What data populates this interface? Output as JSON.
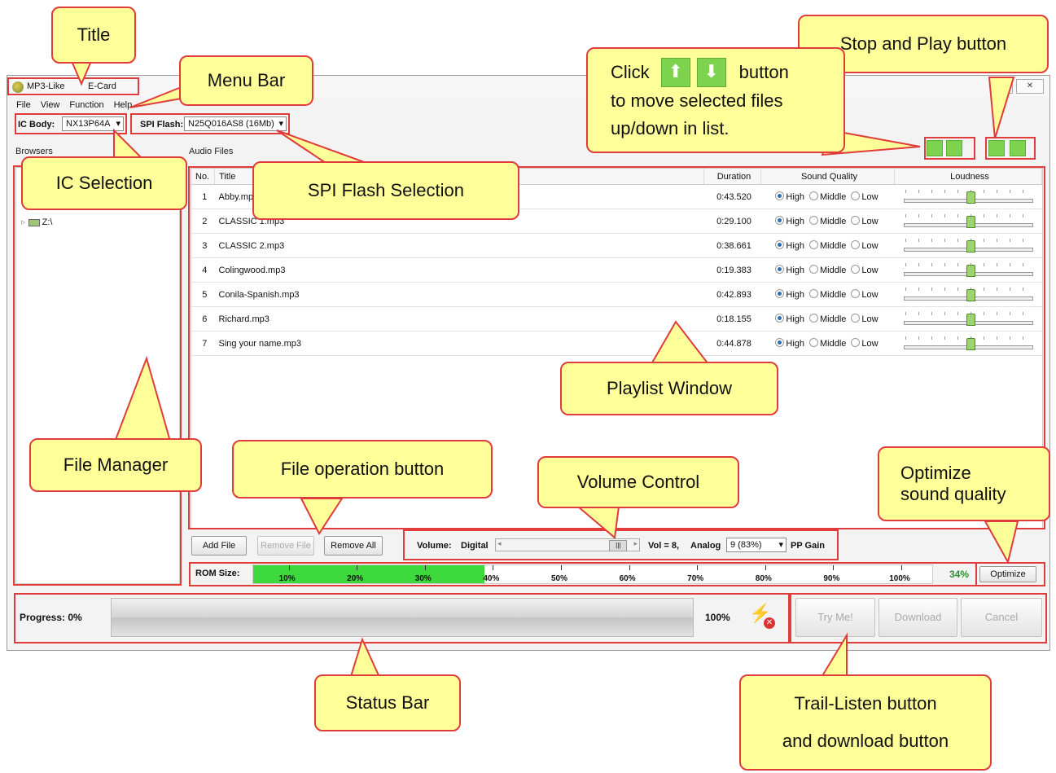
{
  "window": {
    "title": "MP3-Like",
    "subtitle": "E-Card"
  },
  "menu": [
    "File",
    "View",
    "Function",
    "Help"
  ],
  "toolbar": {
    "ic_body_label": "IC Body:",
    "ic_body_value": "NX13P64A",
    "spi_flash_label": "SPI Flash:",
    "spi_flash_value": "N25Q016AS8 (16Mb)"
  },
  "browser": {
    "label": "Browsers",
    "drive": "Z:\\"
  },
  "playlist": {
    "label": "Audio Files",
    "columns": [
      "No.",
      "Title",
      "Duration",
      "Sound Quality",
      "Loudness"
    ],
    "quality_options": [
      "High",
      "Middle",
      "Low"
    ],
    "rows": [
      {
        "no": "1",
        "title": "Abby.mp3",
        "duration": "0:43.520",
        "quality": "High",
        "loudness": 0.5
      },
      {
        "no": "2",
        "title": "CLASSIC 1.mp3",
        "duration": "0:29.100",
        "quality": "High",
        "loudness": 0.5
      },
      {
        "no": "3",
        "title": "CLASSIC 2.mp3",
        "duration": "0:38.661",
        "quality": "High",
        "loudness": 0.5
      },
      {
        "no": "4",
        "title": "Colingwood.mp3",
        "duration": "0:19.383",
        "quality": "High",
        "loudness": 0.5
      },
      {
        "no": "5",
        "title": "Conila-Spanish.mp3",
        "duration": "0:42.893",
        "quality": "High",
        "loudness": 0.5
      },
      {
        "no": "6",
        "title": "Richard.mp3",
        "duration": "0:18.155",
        "quality": "High",
        "loudness": 0.5
      },
      {
        "no": "7",
        "title": "Sing your name.mp3",
        "duration": "0:44.878",
        "quality": "High",
        "loudness": 0.5
      }
    ]
  },
  "file_buttons": {
    "add": "Add File",
    "remove": "Remove File",
    "remove_all": "Remove All"
  },
  "volume": {
    "label": "Volume:",
    "digital_label": "Digital",
    "vol_text": "Vol = 8,",
    "analog_label": "Analog",
    "analog_value": "9 (83%)",
    "pp_gain": "PP Gain",
    "level": 0.95
  },
  "rom": {
    "label": "ROM Size:",
    "ticks": [
      "10%",
      "20%",
      "30%",
      "40%",
      "50%",
      "60%",
      "70%",
      "80%",
      "90%",
      "100%"
    ],
    "used_percent_text": "34%",
    "used_fraction": 0.34,
    "optimize_label": "Optimize"
  },
  "status": {
    "progress_label": "Progress: 0%",
    "end_label": "100%",
    "progress_fraction": 0
  },
  "action_buttons": {
    "try": "Try Me!",
    "download": "Download",
    "cancel": "Cancel"
  },
  "callouts": {
    "title": "Title",
    "menu_bar": "Menu Bar",
    "ic_selection": "IC Selection",
    "spi_flash_selection": "SPI Flash Selection",
    "file_manager": "File Manager",
    "file_operation": "File operation button",
    "volume_control": "Volume Control",
    "playlist_window": "Playlist Window",
    "optimize_line1": "Optimize",
    "optimize_line2": "sound quality",
    "status_bar": "Status Bar",
    "stop_play": "Stop and Play button",
    "trail_line1": "Trail-Listen button",
    "trail_line2": "and download button",
    "move_click": "Click",
    "move_button": "button",
    "move_line2": "to move selected files",
    "move_line3": "up/down in list."
  },
  "colors": {
    "callout_fill": "#ffff99",
    "callout_border": "#e03c3c",
    "rom_fill": "#3cd83c",
    "percent_text": "#2f8f2f"
  }
}
